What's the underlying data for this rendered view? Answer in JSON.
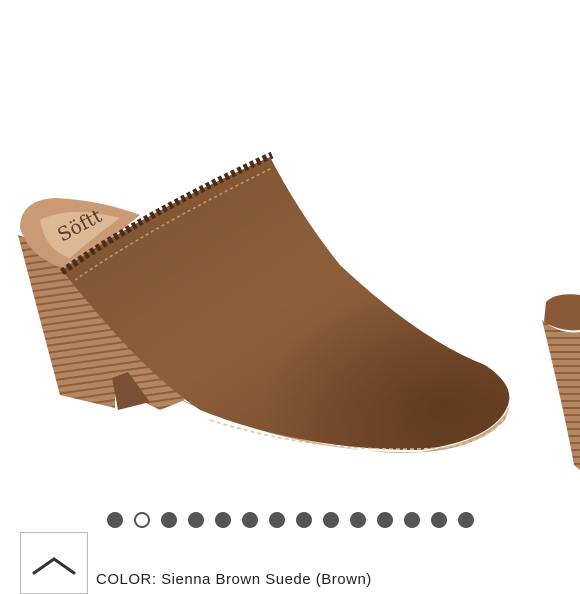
{
  "product": {
    "image_alt": "Brown suede mule with stacked wooden heel",
    "brand_mark": "Söftt"
  },
  "carousel": {
    "dot_count": 14,
    "active_index": 1
  },
  "details": {
    "color_text": "COLOR: Sienna Brown Suede (Brown)"
  },
  "colors": {
    "suede": "#8a5a36",
    "heel": "#a87a56",
    "dot": "#555555"
  }
}
